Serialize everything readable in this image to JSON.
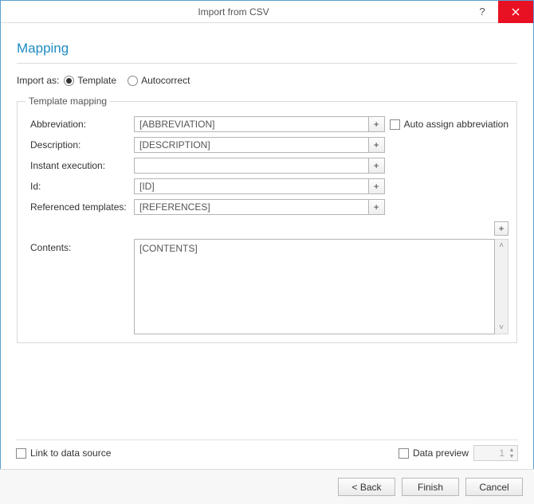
{
  "window": {
    "title": "Import from CSV"
  },
  "heading": "Mapping",
  "import_as": {
    "label": "Import as:",
    "template": "Template",
    "autocorrect": "Autocorrect",
    "selected": "template"
  },
  "group": {
    "legend": "Template mapping",
    "rows": {
      "abbreviation": {
        "label": "Abbreviation:",
        "value": "[ABBREVIATION]"
      },
      "description": {
        "label": "Description:",
        "value": "[DESCRIPTION]"
      },
      "instant": {
        "label": "Instant execution:",
        "value": ""
      },
      "id": {
        "label": "Id:",
        "value": "[ID]"
      },
      "referenced": {
        "label": "Referenced templates:",
        "value": "[REFERENCES]"
      },
      "contents": {
        "label": "Contents:",
        "value": "[CONTENTS]"
      }
    },
    "auto_assign": "Auto assign abbreviation"
  },
  "bottom": {
    "link_to_source": "Link to data source",
    "data_preview": "Data preview",
    "preview_index": "1"
  },
  "footer": {
    "back": "<  Back",
    "finish": "Finish",
    "cancel": "Cancel"
  }
}
